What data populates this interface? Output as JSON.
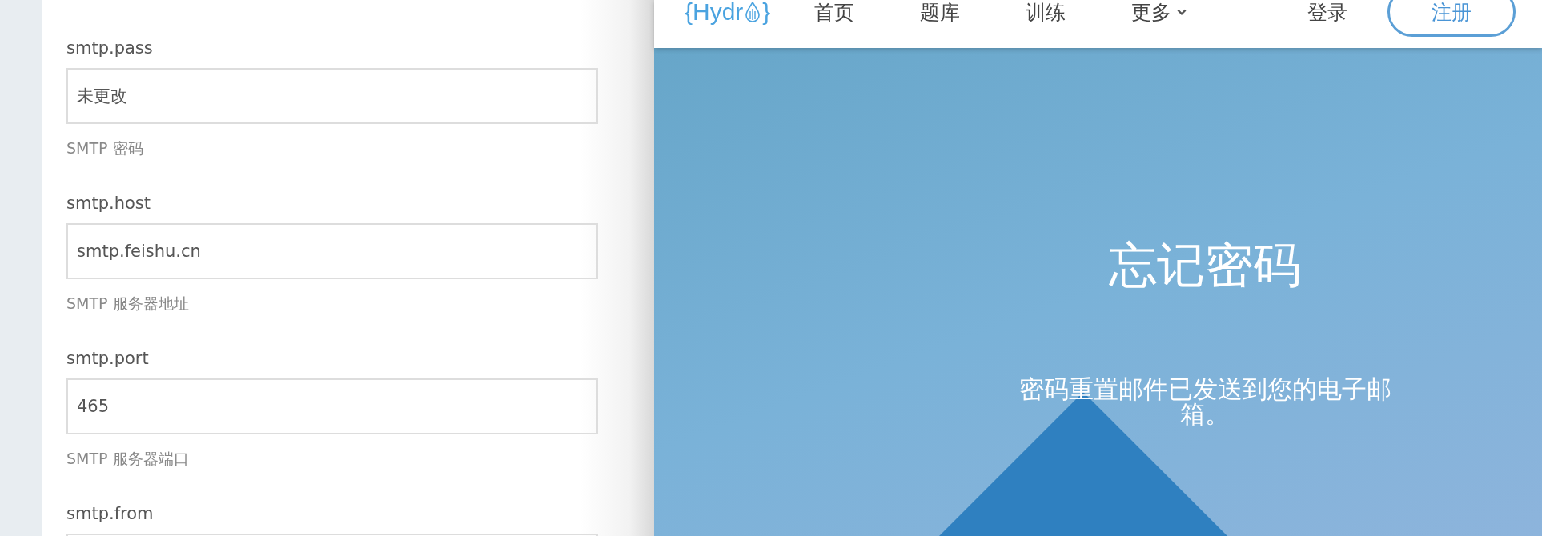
{
  "settings": {
    "fields": [
      {
        "label": "smtp.pass",
        "value": "未更改",
        "hint": "SMTP 密码"
      },
      {
        "label": "smtp.host",
        "value": "smtp.feishu.cn",
        "hint": "SMTP 服务器地址"
      },
      {
        "label": "smtp.port",
        "value": "465",
        "hint": "SMTP 服务器端口"
      },
      {
        "label": "smtp.from"
      }
    ]
  },
  "nav": {
    "logo": {
      "text_before": "{Hydr",
      "text_after": "}"
    },
    "items": [
      {
        "label": "首页",
        "has_caret": false
      },
      {
        "label": "题库",
        "has_caret": false
      },
      {
        "label": "训练",
        "has_caret": false
      },
      {
        "label": "更多",
        "has_caret": true
      }
    ],
    "login": "登录",
    "register": "注册"
  },
  "hero": {
    "title": "忘记密码",
    "message": "密码重置邮件已发送到您的电子邮箱。"
  }
}
